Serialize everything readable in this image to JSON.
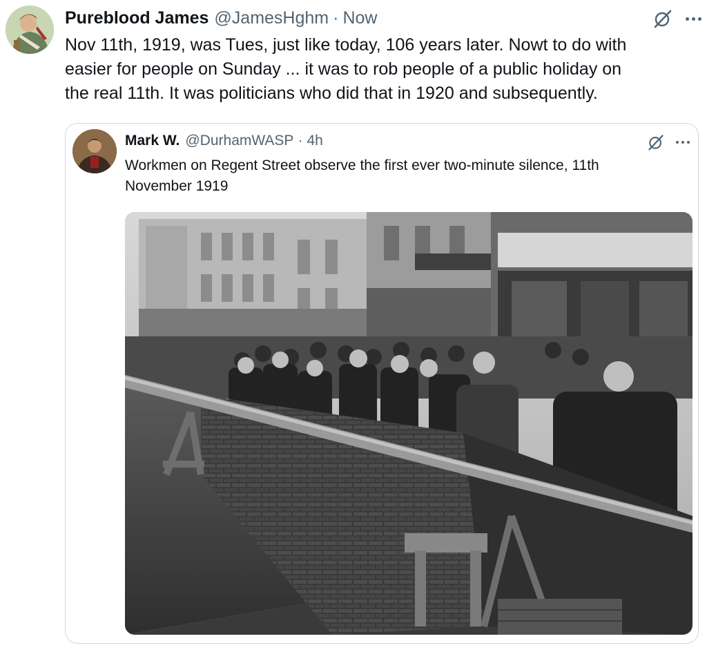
{
  "tweet": {
    "display_name": "Pureblood James",
    "handle": "@JamesHghm",
    "separator": "·",
    "time": "Now",
    "text_lines": [
      "Nov 11th, 1919, was Tues, just like today, 106 years later. Nowt to do with",
      "easier for people on Sunday ... it was to rob people of a public holiday on",
      "the real 11th. It was politicians who did that in 1920 and subsequently."
    ]
  },
  "quoted": {
    "display_name": "Mark W.",
    "handle": "@DurhamWASP",
    "separator": "·",
    "time": "4h",
    "text_lines": [
      "Workmen on Regent Street observe the first ever two-minute silence, 11th",
      "November 1919"
    ]
  },
  "icons": {
    "grok": "grok-icon",
    "more": "more-icon"
  },
  "colors": {
    "text_primary": "#0f1419",
    "text_secondary": "#536471",
    "border": "#cfd9de"
  }
}
